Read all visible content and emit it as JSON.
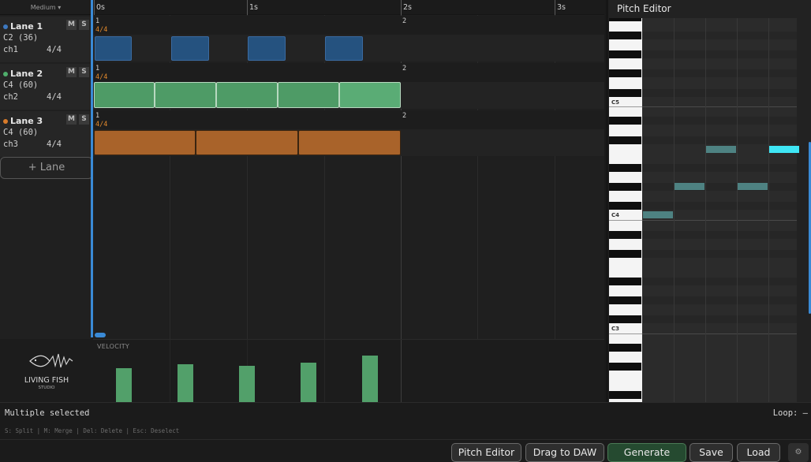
{
  "zoom": {
    "label": "Medium ▾"
  },
  "ruler": {
    "labels": [
      "0s",
      "1s",
      "2s",
      "3s"
    ]
  },
  "lanes": [
    {
      "name": "Lane 1",
      "note": "C2 (36)",
      "channel": "ch1",
      "time_sig": "4/4",
      "color": "#3d78c0",
      "clip_color": "#25527f",
      "mute": "M",
      "solo": "S",
      "bar_labels": [
        "1",
        "2"
      ],
      "bar_ts": "4/4"
    },
    {
      "name": "Lane 2",
      "note": "C4 (60)",
      "channel": "ch2",
      "time_sig": "4/4",
      "color": "#4fae6c",
      "clip_color": "#4e9b66",
      "mute": "M",
      "solo": "S",
      "bar_labels": [
        "1",
        "2"
      ],
      "bar_ts": "4/4"
    },
    {
      "name": "Lane 3",
      "note": "C4 (60)",
      "channel": "ch3",
      "time_sig": "4/4",
      "color": "#d97b2a",
      "clip_color": "#a9632a",
      "mute": "M",
      "solo": "S",
      "bar_labels": [
        "1",
        "2"
      ],
      "bar_ts": "4/4"
    }
  ],
  "add_lane": {
    "label": "+ Lane"
  },
  "velocity": {
    "label": "VELOCITY",
    "values": [
      0.62,
      0.68,
      0.66,
      0.72,
      0.84
    ]
  },
  "logo": {
    "title": "LIVING FISH",
    "subtitle": "STUDIO"
  },
  "pitch_editor": {
    "title": "Pitch Editor",
    "octaves": [
      "C5",
      "C4",
      "C3"
    ]
  },
  "status": {
    "text": "Multiple selected",
    "loop": "Loop: –"
  },
  "shortcuts": {
    "text": "S: Split | M: Merge | Del: Delete | Esc: Deselect"
  },
  "toolbar": {
    "pitch_editor": "Pitch Editor",
    "drag_to_daw": "Drag to DAW",
    "generate": "Generate",
    "save": "Save",
    "load": "Load",
    "settings_icon": "⚙"
  }
}
